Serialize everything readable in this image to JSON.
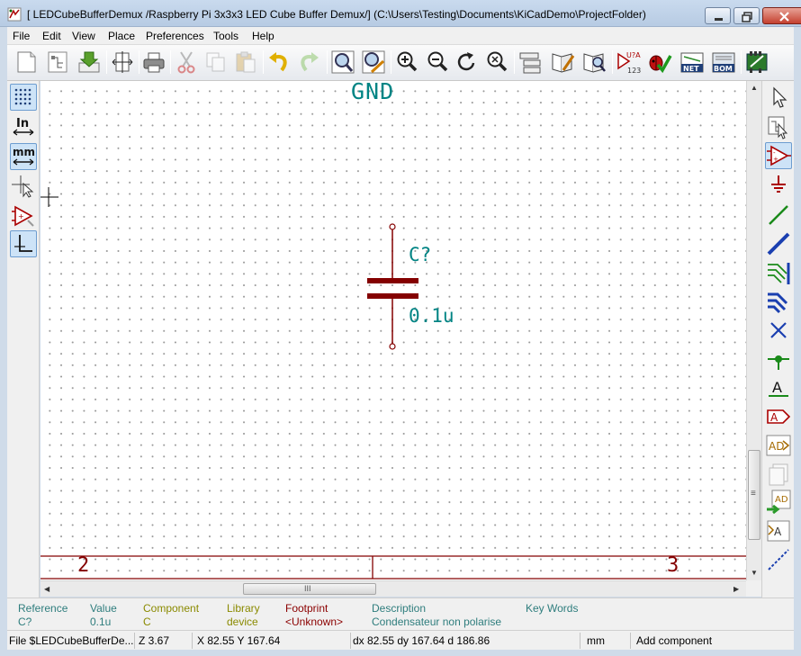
{
  "window": {
    "title": "[ LEDCubeBufferDemux /Raspberry Pi 3x3x3 LED Cube Buffer Demux/] (C:\\Users\\Testing\\Documents\\KiCadDemo\\ProjectFolder)"
  },
  "menu": [
    "File",
    "Edit",
    "View",
    "Place",
    "Preferences",
    "Tools",
    "Help"
  ],
  "toolbar_icons": [
    "new-sheet-icon",
    "hierarchy-icon",
    "save-icon",
    "page-settings-icon",
    "print-icon",
    "cut-icon",
    "copy-icon",
    "paste-icon",
    "undo-icon",
    "redo-icon",
    "find-icon",
    "find-replace-icon",
    "zoom-in-icon",
    "zoom-out-icon",
    "zoom-redraw-icon",
    "zoom-fit-icon",
    "navigate-hierarchy-icon",
    "library-editor-icon",
    "library-browser-icon",
    "annotate-icon",
    "erc-icon",
    "netlist-icon",
    "bom-icon",
    "cvpcb-icon"
  ],
  "left_tools": [
    "grid-toggle-icon",
    "units-inch-icon",
    "units-mm-icon",
    "cursor-shape-icon",
    "hidden-pins-icon",
    "wire-angle-icon"
  ],
  "left_tool_labels": {
    "in": "In",
    "mm": "mm"
  },
  "right_tools": [
    "select-arrow-icon",
    "hierarchy-navigator-icon",
    "add-component-icon",
    "add-power-icon",
    "add-wire-icon",
    "add-bus-icon",
    "wire-to-bus-entry-icon",
    "bus-to-bus-entry-icon",
    "no-connect-icon",
    "junction-icon",
    "net-label-icon",
    "global-label-icon",
    "hierarchical-label-icon",
    "hierarchical-sheet-icon",
    "import-sheet-pin-icon",
    "add-sheet-pin-icon",
    "add-graphic-line-icon"
  ],
  "right_tool_labels": {
    "net_label": "A"
  },
  "schematic": {
    "gnd_text": "GND",
    "reference": "C?",
    "value": "0.1u",
    "border_left_number": "2",
    "border_right_number": "3"
  },
  "hscroll_grip": "III",
  "vscroll_grip": "≡",
  "info_panel": [
    {
      "label": "Reference",
      "value": "C?",
      "label_color": "#2e7d7d",
      "value_color": "#2e7d7d"
    },
    {
      "label": "Value",
      "value": "0.1u",
      "label_color": "#2e7d7d",
      "value_color": "#2e7d7d"
    },
    {
      "label": "Component",
      "value": "C",
      "label_color": "#8a8a00",
      "value_color": "#8a8a00"
    },
    {
      "label": "Library",
      "value": "device",
      "label_color": "#8a8a00",
      "value_color": "#8a8a00"
    },
    {
      "label": "Footprint",
      "value": "<Unknown>",
      "label_color": "#8b0000",
      "value_color": "#8b0000"
    },
    {
      "label": "Description",
      "value": "Condensateur non polarise",
      "label_color": "#2e7d7d",
      "value_color": "#2e7d7d"
    },
    {
      "label": "Key Words",
      "value": "",
      "label_color": "#2e7d7d",
      "value_color": "#2e7d7d"
    }
  ],
  "status": {
    "file": "File $LEDCubeBufferDe...",
    "zoom": "Z 3.67",
    "xy": "X 82.55  Y 167.64",
    "delta": "dx 82.55  dy 167.64  d 186.86",
    "units": "mm",
    "action": "Add component"
  },
  "colors": {
    "component_body": "#840000",
    "field_text": "#008484",
    "border": "#840000",
    "canvas_bg": "#ffffff"
  }
}
